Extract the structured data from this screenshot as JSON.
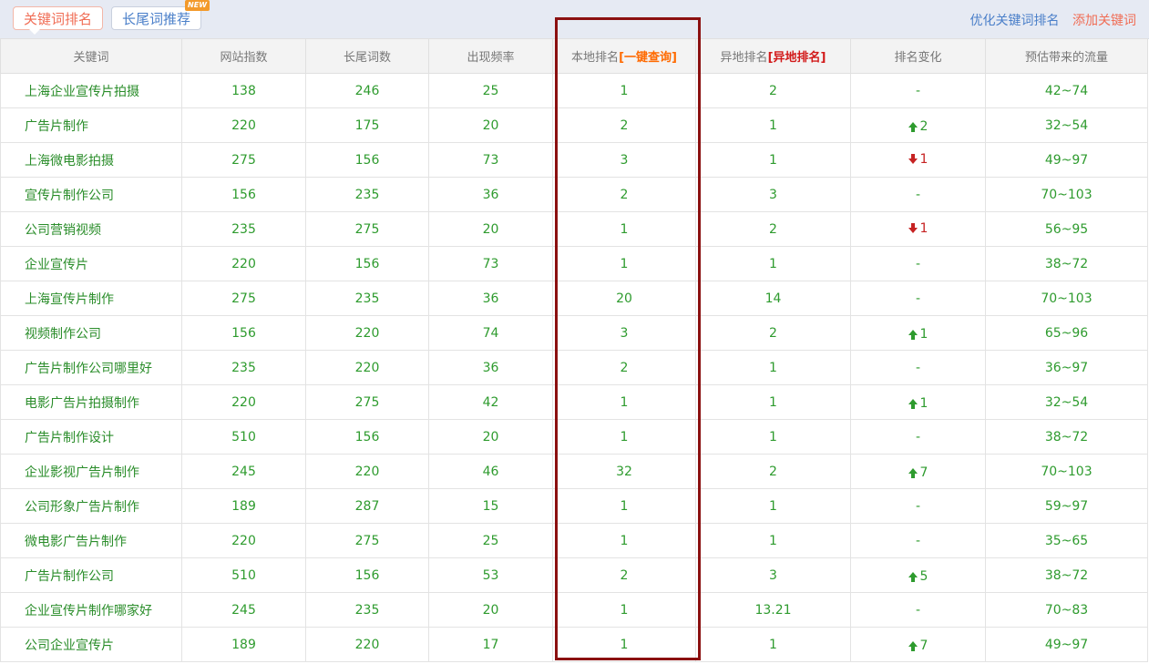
{
  "tabs": {
    "keyword_rank": "关键词排名",
    "longtail": "长尾词推荐",
    "new_badge": "NEW"
  },
  "links": {
    "optimize": "优化关键词排名",
    "add": "添加关键词"
  },
  "colors": {
    "accent_orange": "#f06d55",
    "link_blue": "#4a7fc9",
    "green": "#2e9b2e",
    "red": "#c62222",
    "highlight": "#8b1010"
  },
  "headers": {
    "keyword": "关键词",
    "index": "网站指数",
    "longtail_count": "长尾词数",
    "frequency": "出现频率",
    "local_rank": "本地排名",
    "local_rank_link": "[一键查询]",
    "remote_rank": "异地排名",
    "remote_rank_link": "[异地排名]",
    "rank_change": "排名变化",
    "traffic": "预估带来的流量"
  },
  "rows": [
    {
      "kw": "上海企业宣传片拍摄",
      "index": "138",
      "longtail": "246",
      "freq": "25",
      "local": "1",
      "remote": "2",
      "dir": "none",
      "chg": "-",
      "traffic": "42~74"
    },
    {
      "kw": "广告片制作",
      "index": "220",
      "longtail": "175",
      "freq": "20",
      "local": "2",
      "remote": "1",
      "dir": "up",
      "chg": "2",
      "traffic": "32~54"
    },
    {
      "kw": "上海微电影拍摄",
      "index": "275",
      "longtail": "156",
      "freq": "73",
      "local": "3",
      "remote": "1",
      "dir": "down",
      "chg": "1",
      "traffic": "49~97"
    },
    {
      "kw": "宣传片制作公司",
      "index": "156",
      "longtail": "235",
      "freq": "36",
      "local": "2",
      "remote": "3",
      "dir": "none",
      "chg": "-",
      "traffic": "70~103"
    },
    {
      "kw": "公司营销视频",
      "index": "235",
      "longtail": "275",
      "freq": "20",
      "local": "1",
      "remote": "2",
      "dir": "down",
      "chg": "1",
      "traffic": "56~95"
    },
    {
      "kw": "企业宣传片",
      "index": "220",
      "longtail": "156",
      "freq": "73",
      "local": "1",
      "remote": "1",
      "dir": "none",
      "chg": "-",
      "traffic": "38~72"
    },
    {
      "kw": "上海宣传片制作",
      "index": "275",
      "longtail": "235",
      "freq": "36",
      "local": "20",
      "remote": "14",
      "dir": "none",
      "chg": "-",
      "traffic": "70~103"
    },
    {
      "kw": "视频制作公司",
      "index": "156",
      "longtail": "220",
      "freq": "74",
      "local": "3",
      "remote": "2",
      "dir": "up",
      "chg": "1",
      "traffic": "65~96"
    },
    {
      "kw": "广告片制作公司哪里好",
      "index": "235",
      "longtail": "220",
      "freq": "36",
      "local": "2",
      "remote": "1",
      "dir": "none",
      "chg": "-",
      "traffic": "36~97"
    },
    {
      "kw": "电影广告片拍摄制作",
      "index": "220",
      "longtail": "275",
      "freq": "42",
      "local": "1",
      "remote": "1",
      "dir": "up",
      "chg": "1",
      "traffic": "32~54"
    },
    {
      "kw": "广告片制作设计",
      "index": "510",
      "longtail": "156",
      "freq": "20",
      "local": "1",
      "remote": "1",
      "dir": "none",
      "chg": "-",
      "traffic": "38~72"
    },
    {
      "kw": "企业影视广告片制作",
      "index": "245",
      "longtail": "220",
      "freq": "46",
      "local": "32",
      "remote": "2",
      "dir": "up",
      "chg": "7",
      "traffic": "70~103"
    },
    {
      "kw": "公司形象广告片制作",
      "index": "189",
      "longtail": "287",
      "freq": "15",
      "local": "1",
      "remote": "1",
      "dir": "none",
      "chg": "-",
      "traffic": "59~97"
    },
    {
      "kw": "微电影广告片制作",
      "index": "220",
      "longtail": "275",
      "freq": "25",
      "local": "1",
      "remote": "1",
      "dir": "none",
      "chg": "-",
      "traffic": "35~65"
    },
    {
      "kw": "广告片制作公司",
      "index": "510",
      "longtail": "156",
      "freq": "53",
      "local": "2",
      "remote": "3",
      "dir": "up",
      "chg": "5",
      "traffic": "38~72"
    },
    {
      "kw": "企业宣传片制作哪家好",
      "index": "245",
      "longtail": "235",
      "freq": "20",
      "local": "1",
      "remote": "13.21",
      "dir": "none",
      "chg": "-",
      "traffic": "70~83"
    },
    {
      "kw": "公司企业宣传片",
      "index": "189",
      "longtail": "220",
      "freq": "17",
      "local": "1",
      "remote": "1",
      "dir": "up",
      "chg": "7",
      "traffic": "49~97"
    }
  ]
}
